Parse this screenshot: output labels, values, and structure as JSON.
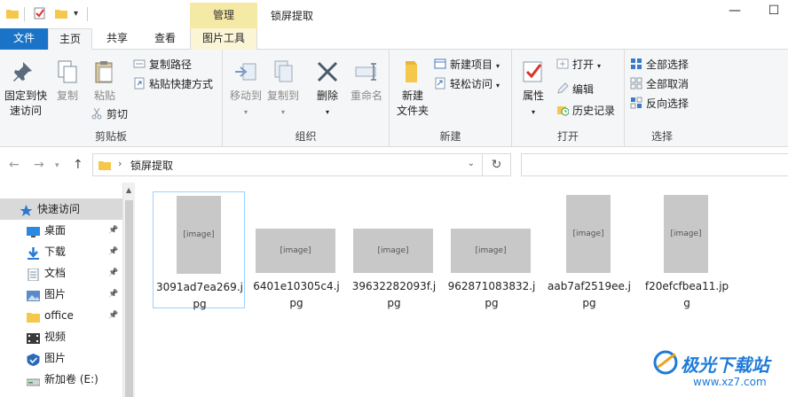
{
  "window": {
    "title": "锁屏提取",
    "context_tab_header": "管理",
    "minimize": "—",
    "maximize": "☐"
  },
  "tabs": {
    "file": "文件",
    "home": "主页",
    "share": "共享",
    "view": "查看",
    "picture_tools": "图片工具"
  },
  "ribbon": {
    "clipboard": {
      "label": "剪贴板",
      "pin": "固定到快\n速访问",
      "pin_l1": "固定到快",
      "pin_l2": "速访问",
      "copy": "复制",
      "paste": "粘贴",
      "copy_path": "复制路径",
      "paste_shortcut": "粘贴快捷方式",
      "cut": "剪切"
    },
    "organize": {
      "label": "组织",
      "move_to": "移动到",
      "copy_to": "复制到",
      "delete": "删除",
      "rename": "重命名"
    },
    "new": {
      "label": "新建",
      "new_folder_l1": "新建",
      "new_folder_l2": "文件夹",
      "new_item": "新建项目",
      "easy_access": "轻松访问"
    },
    "open": {
      "label": "打开",
      "properties": "属性",
      "open": "打开",
      "edit": "编辑",
      "history": "历史记录"
    },
    "select": {
      "label": "选择",
      "select_all": "全部选择",
      "select_none": "全部取消",
      "invert": "反向选择"
    }
  },
  "address": {
    "path": "锁屏提取"
  },
  "nav": {
    "items": [
      {
        "label": "快速访问",
        "icon": "star-icon",
        "pinned": false
      },
      {
        "label": "桌面",
        "icon": "desktop-icon",
        "pinned": true
      },
      {
        "label": "下载",
        "icon": "download-icon",
        "pinned": true
      },
      {
        "label": "文档",
        "icon": "document-icon",
        "pinned": true
      },
      {
        "label": "图片",
        "icon": "pictures-icon",
        "pinned": true
      },
      {
        "label": "office",
        "icon": "folder-icon",
        "pinned": true
      },
      {
        "label": "视频",
        "icon": "video-icon",
        "pinned": false
      },
      {
        "label": "图片",
        "icon": "pictures-folder-icon",
        "pinned": false
      },
      {
        "label": "新加卷 (E:)",
        "icon": "drive-icon",
        "pinned": false
      }
    ]
  },
  "files": [
    {
      "name": "3091ad7ea269.jpg",
      "line1": "3091ad7ea269.j",
      "line2": "pg",
      "orientation": "portrait",
      "selected": true
    },
    {
      "name": "6401e10305c4.jpg",
      "line1": "6401e10305c4.j",
      "line2": "pg",
      "orientation": "landscape",
      "selected": false
    },
    {
      "name": "39632282093f.jpg",
      "line1": "39632282093f.j",
      "line2": "pg",
      "orientation": "landscape",
      "selected": false
    },
    {
      "name": "962871083832.jpg",
      "line1": "962871083832.j",
      "line2": "pg",
      "orientation": "landscape",
      "selected": false
    },
    {
      "name": "aab7af2519ee.jpg",
      "line1": "aab7af2519ee.j",
      "line2": "pg",
      "orientation": "portrait",
      "selected": false
    },
    {
      "name": "f20efcfbea11.jpg",
      "line1": "f20efcfbea11.jp",
      "line2": "g",
      "orientation": "portrait",
      "selected": false
    }
  ],
  "watermark": {
    "title": "极光下载站",
    "url": "www.xz7.com"
  },
  "colors": {
    "file_tab": "#1a73c7",
    "context_tab": "#f5e9a6",
    "selection_border": "#99d1ff",
    "ribbon_bg": "#f5f6f7",
    "folder": "#f5c84c"
  }
}
